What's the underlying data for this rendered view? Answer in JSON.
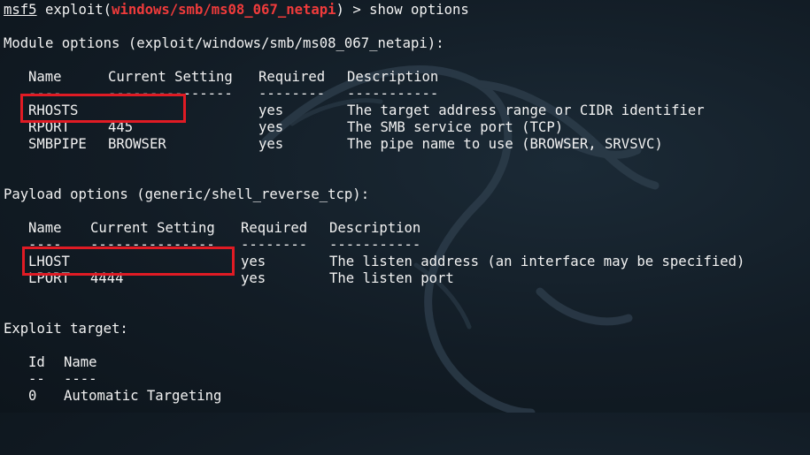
{
  "prompt": {
    "prefix": "msf5",
    "command_open": " exploit(",
    "module": "windows/smb/ms08_067_netapi",
    "command_close": ") > show options"
  },
  "module_options": {
    "title": "Module options (exploit/windows/smb/ms08_067_netapi):",
    "headers": {
      "name": "Name",
      "setting": "Current Setting",
      "required": "Required",
      "description": "Description"
    },
    "underlines": {
      "name": "----",
      "setting": "---------------",
      "required": "--------",
      "description": "-----------"
    },
    "rows": [
      {
        "name": "RHOSTS",
        "setting": "",
        "required": "yes",
        "description": "The target address range or CIDR identifier"
      },
      {
        "name": "RPORT",
        "setting": "445",
        "required": "yes",
        "description": "The SMB service port (TCP)"
      },
      {
        "name": "SMBPIPE",
        "setting": "BROWSER",
        "required": "yes",
        "description": "The pipe name to use (BROWSER, SRVSVC)"
      }
    ]
  },
  "payload_options": {
    "title": "Payload options (generic/shell_reverse_tcp):",
    "headers": {
      "name": "Name",
      "setting": "Current Setting",
      "required": "Required",
      "description": "Description"
    },
    "underlines": {
      "name": "----",
      "setting": "---------------",
      "required": "--------",
      "description": "-----------"
    },
    "rows": [
      {
        "name": "LHOST",
        "setting": "",
        "required": "yes",
        "description": "The listen address (an interface may be specified)"
      },
      {
        "name": "LPORT",
        "setting": "4444",
        "required": "yes",
        "description": "The listen port"
      }
    ]
  },
  "exploit_target": {
    "title": "Exploit target:",
    "headers": {
      "id": "Id",
      "name": "Name"
    },
    "underlines": {
      "id": "--",
      "name": "----"
    },
    "rows": [
      {
        "id": "0",
        "name": "Automatic Targeting"
      }
    ]
  },
  "colors": {
    "module_name": "#ef3b3b",
    "highlight_box": "#e01b24",
    "text": "#f2f2f2"
  },
  "icons": {
    "background": "kali-dragon-icon"
  }
}
